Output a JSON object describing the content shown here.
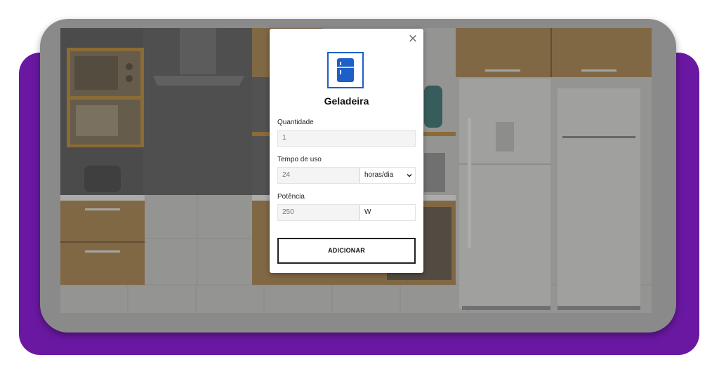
{
  "modal": {
    "close_symbol": "×",
    "icon": "fridge-icon",
    "title": "Geladeira",
    "quantity": {
      "label": "Quantidade",
      "value": "1"
    },
    "usage_time": {
      "label": "Tempo de uso",
      "value": "24",
      "unit": "horas/dia"
    },
    "power": {
      "label": "Potência",
      "value": "250",
      "unit": "W"
    },
    "add_button": "ADICIONAR"
  },
  "colors": {
    "accent_blue": "#1c5fc9",
    "frame_purple": "#6a18a2",
    "device_gray": "#8a8a8a"
  }
}
